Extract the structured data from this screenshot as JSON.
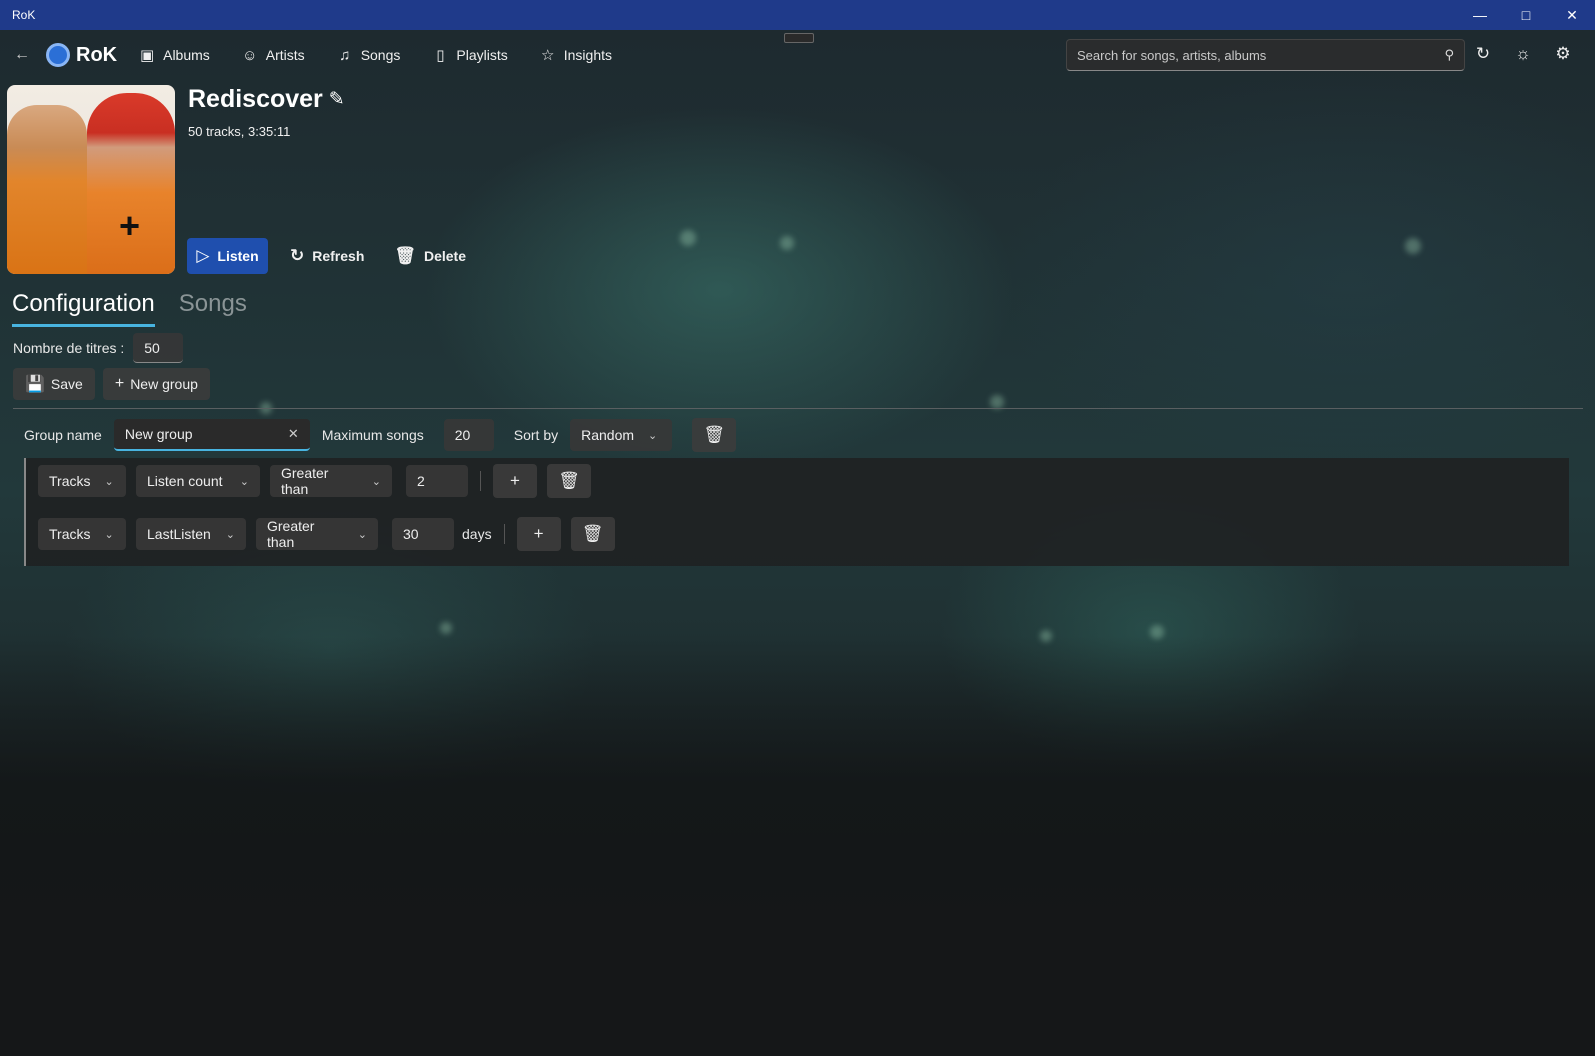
{
  "window": {
    "title": "RoK",
    "controls": [
      "minimize",
      "maximize",
      "close"
    ]
  },
  "nav": {
    "brand": "RoK",
    "items": [
      {
        "label": "Albums",
        "icon": "albums-icon"
      },
      {
        "label": "Artists",
        "icon": "artists-icon"
      },
      {
        "label": "Songs",
        "icon": "songs-icon"
      },
      {
        "label": "Playlists",
        "icon": "playlists-icon"
      },
      {
        "label": "Insights",
        "icon": "insights-icon"
      }
    ],
    "search_placeholder": "Search for songs, artists, albums"
  },
  "playlist": {
    "title": "Rediscover",
    "subtitle": "50 tracks, 3:35:11",
    "actions": {
      "listen": "Listen",
      "refresh": "Refresh",
      "delete": "Delete"
    }
  },
  "tabs": [
    {
      "label": "Configuration",
      "active": true
    },
    {
      "label": "Songs",
      "active": false
    }
  ],
  "config": {
    "count_label": "Nombre de titres :",
    "count_value": "50",
    "save_label": "Save",
    "new_group_label": "New group",
    "group": {
      "name_label": "Group name",
      "name_value": "New group",
      "max_label": "Maximum songs",
      "max_value": "20",
      "sort_label": "Sort by",
      "sort_value": "Random"
    },
    "rules": [
      {
        "source": "Tracks",
        "field": "Listen count",
        "op": "Greater than",
        "value": "2",
        "unit": ""
      },
      {
        "source": "Tracks",
        "field": "LastListen",
        "op": "Greater than",
        "value": "30",
        "unit": "days"
      }
    ]
  },
  "colors": {
    "titlebar": "#1f3a8a",
    "accent": "#48b4e0",
    "listen_button": "#1f4fae"
  }
}
